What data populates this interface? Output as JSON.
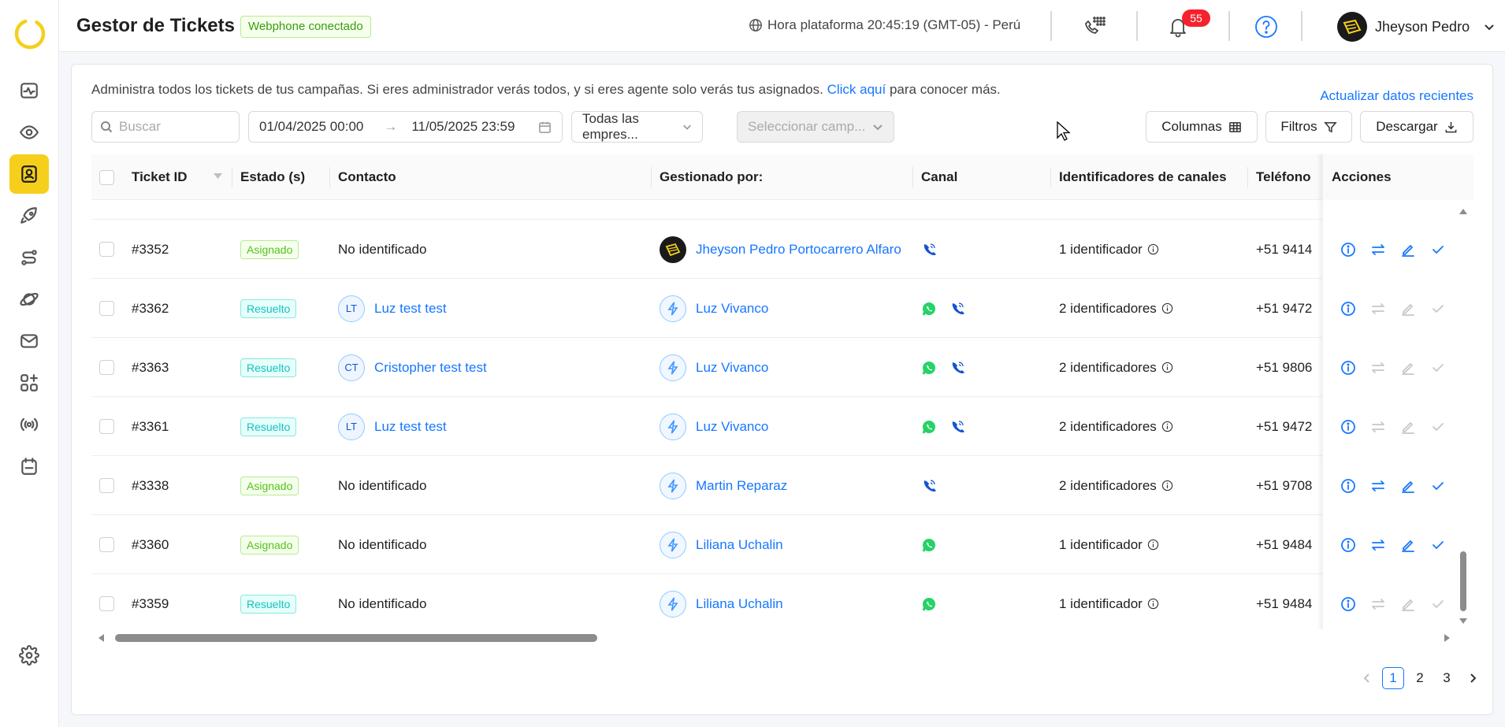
{
  "app": {
    "title": "Gestor de Tickets",
    "status_badge": "Webphone conectado",
    "platform_time": "Hora plataforma 20:45:19 (GMT-05) - Perú",
    "notification_count": "55",
    "user_name": "Jheyson Pedro"
  },
  "colors": {
    "accent": "#f5cf1b",
    "link": "#1677ff",
    "assigned": "#52c41a",
    "resolved": "#13c2c2",
    "badge_red": "#f5222d"
  },
  "sidebar": {
    "items": [
      {
        "icon": "activity-icon",
        "active": false
      },
      {
        "icon": "eye-icon",
        "active": false
      },
      {
        "icon": "contact-card-icon",
        "active": true
      },
      {
        "icon": "rocket-icon",
        "active": false
      },
      {
        "icon": "route-icon",
        "active": false
      },
      {
        "icon": "planet-icon",
        "active": false
      },
      {
        "icon": "mail-icon",
        "active": false
      },
      {
        "icon": "apps-add-icon",
        "active": false
      },
      {
        "icon": "broadcast-icon",
        "active": false
      },
      {
        "icon": "calendar-icon",
        "active": false
      }
    ],
    "settings_icon": "gear-icon"
  },
  "intro": {
    "text": "Administra todos los tickets de tus campañas. Si eres administrador verás todos, y si eres agente solo verás tus asignados.",
    "link": "Click aquí",
    "suffix": "para conocer más.",
    "refresh": "Actualizar datos recientes"
  },
  "filters": {
    "search_placeholder": "Buscar",
    "date_start": "01/04/2025 00:00",
    "date_end": "11/05/2025 23:59",
    "company": "Todas las empres...",
    "campaign_placeholder": "Seleccionar camp...",
    "columns_btn": "Columnas",
    "filters_btn": "Filtros",
    "download_btn": "Descargar"
  },
  "table": {
    "headers": {
      "ticket_id": "Ticket ID",
      "estado": "Estado (s)",
      "contacto": "Contacto",
      "gestionado": "Gestionado por:",
      "canal": "Canal",
      "identificadores": "Identificadores de canales",
      "telefono": "Teléfono",
      "acciones": "Acciones"
    },
    "rows": [
      {
        "id": "#3352",
        "status": "Asignado",
        "contact": "No identificado",
        "contact_initials": "",
        "agent": "Jheyson Pedro Portocarrero Alfaro",
        "agent_avatar": "logo",
        "channels": [
          "phone"
        ],
        "identifiers": "1 identificador",
        "phone": "+51 9414",
        "actions_enabled": true
      },
      {
        "id": "#3362",
        "status": "Resuelto",
        "contact": "Luz test test",
        "contact_initials": "LT",
        "agent": "Luz Vivanco",
        "agent_avatar": "bolt",
        "channels": [
          "whatsapp",
          "phone"
        ],
        "identifiers": "2 identificadores",
        "phone": "+51 9472",
        "actions_enabled": false
      },
      {
        "id": "#3363",
        "status": "Resuelto",
        "contact": "Cristopher test test",
        "contact_initials": "CT",
        "agent": "Luz Vivanco",
        "agent_avatar": "bolt",
        "channels": [
          "whatsapp",
          "phone"
        ],
        "identifiers": "2 identificadores",
        "phone": "+51 9806",
        "actions_enabled": false
      },
      {
        "id": "#3361",
        "status": "Resuelto",
        "contact": "Luz test test",
        "contact_initials": "LT",
        "agent": "Luz Vivanco",
        "agent_avatar": "bolt",
        "channels": [
          "whatsapp",
          "phone"
        ],
        "identifiers": "2 identificadores",
        "phone": "+51 9472",
        "actions_enabled": false
      },
      {
        "id": "#3338",
        "status": "Asignado",
        "contact": "No identificado",
        "contact_initials": "",
        "agent": "Martin Reparaz",
        "agent_avatar": "bolt",
        "channels": [
          "phone"
        ],
        "identifiers": "2 identificadores",
        "phone": "+51 9708",
        "actions_enabled": true
      },
      {
        "id": "#3360",
        "status": "Asignado",
        "contact": "No identificado",
        "contact_initials": "",
        "agent": "Liliana Uchalin",
        "agent_avatar": "bolt",
        "channels": [
          "whatsapp"
        ],
        "identifiers": "1 identificador",
        "phone": "+51 9484",
        "actions_enabled": true
      },
      {
        "id": "#3359",
        "status": "Resuelto",
        "contact": "No identificado",
        "contact_initials": "",
        "agent": "Liliana Uchalin",
        "agent_avatar": "bolt",
        "channels": [
          "whatsapp"
        ],
        "identifiers": "1 identificador",
        "phone": "+51 9484",
        "actions_enabled": false
      }
    ]
  },
  "pagination": {
    "pages": [
      "1",
      "2",
      "3"
    ],
    "current": "1"
  }
}
